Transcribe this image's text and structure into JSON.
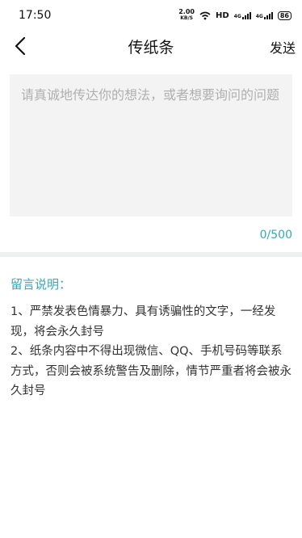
{
  "status_bar": {
    "time": "17:50",
    "net_speed_value": "2.00",
    "net_speed_unit": "KB/S",
    "hd_label": "HD",
    "signal_1": "4G",
    "signal_2": "4G",
    "battery": "86"
  },
  "nav": {
    "back_icon": "chevron-left-icon",
    "title": "传纸条",
    "send_label": "发送"
  },
  "message": {
    "value": "",
    "placeholder": "请真诚地传达你的想法，或者想要询问的问题",
    "counter": "0/500"
  },
  "rules": {
    "title": "留言说明：",
    "items": [
      "1、严禁发表色情暴力、具有诱骗性的文字，一经发现，将会永久封号",
      "2、纸条内容中不得出现微信、QQ、手机号码等联系方式，否则会被系统警告及删除，情节严重者将会被永久封号"
    ]
  },
  "colors": {
    "accent": "#35a9b3",
    "input_bg": "#f3f3f3",
    "placeholder": "#b0b0b0"
  }
}
